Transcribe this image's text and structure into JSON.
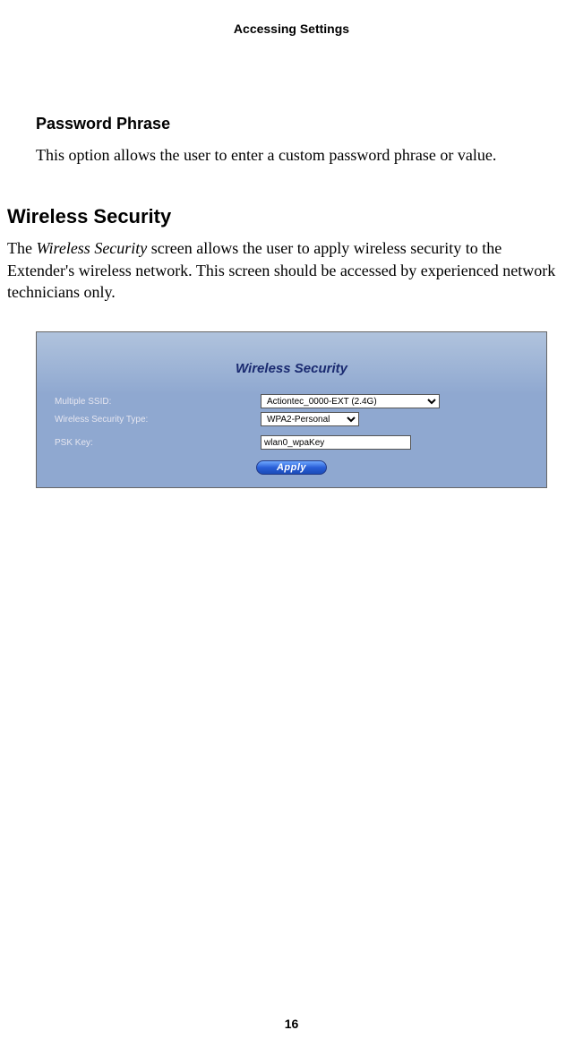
{
  "header": {
    "title": "Accessing Settings"
  },
  "password_phrase": {
    "heading": "Password Phrase",
    "text": "This option allows the user to enter a custom password phrase or value."
  },
  "wireless_security": {
    "heading": "Wireless Security",
    "text_pre": "The ",
    "text_italic": "Wireless Security",
    "text_post": " screen allows the user to apply wireless security to the Extender's wireless network. This screen should be accessed by experienced network technicians only."
  },
  "panel": {
    "title": "Wireless Security",
    "rows": {
      "ssid": {
        "label": "Multiple SSID:",
        "value": "Actiontec_0000-EXT (2.4G)"
      },
      "security_type": {
        "label": "Wireless Security Type:",
        "value": "WPA2-Personal"
      },
      "psk": {
        "label": "PSK Key:",
        "value": "wlan0_wpaKey"
      }
    },
    "apply_label": "Apply"
  },
  "page_number": "16"
}
